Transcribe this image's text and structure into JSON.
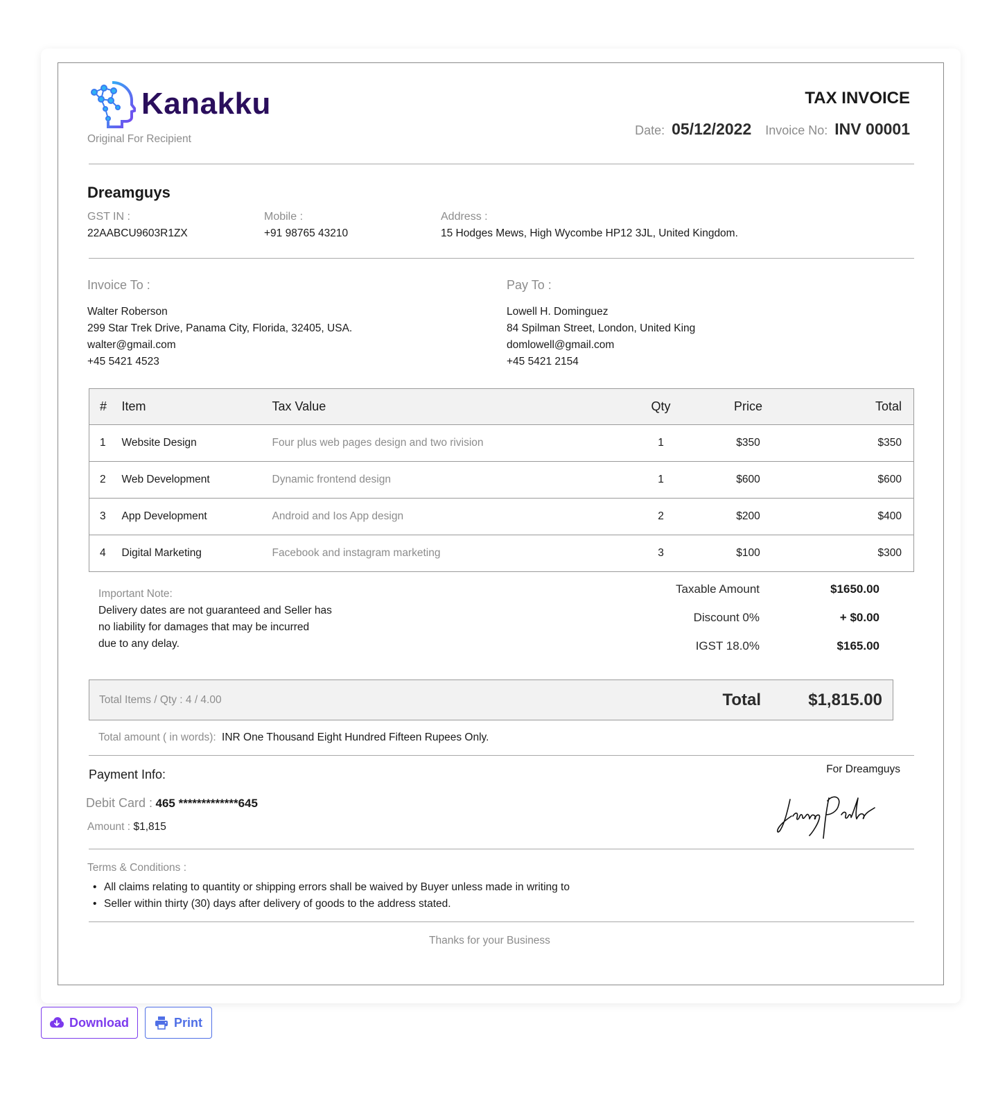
{
  "brand": {
    "name": "Kanakku",
    "copy_type": "Original For Recipient"
  },
  "invoice": {
    "title": "TAX INVOICE",
    "date_label": "Date:",
    "date": "05/12/2022",
    "number_label": "Invoice No:",
    "number": "INV 00001"
  },
  "seller": {
    "name": "Dreamguys",
    "gst_label": "GST IN :",
    "gst": "22AABCU9603R1ZX",
    "mobile_label": "Mobile :",
    "mobile": "+91 98765 43210",
    "address_label": "Address :",
    "address": "15 Hodges Mews, High Wycombe HP12 3JL, United Kingdom."
  },
  "invoice_to": {
    "label": "Invoice To :",
    "name": "Walter Roberson",
    "address": "299 Star Trek Drive, Panama City, Florida, 32405, USA.",
    "email": "walter@gmail.com",
    "phone": "+45 5421 4523"
  },
  "pay_to": {
    "label": "Pay To :",
    "name": "Lowell H. Dominguez",
    "address": "84 Spilman Street, London, United King",
    "email": "domlowell@gmail.com",
    "phone": "+45 5421 2154"
  },
  "table": {
    "headers": {
      "num": "#",
      "item": "Item",
      "tax": "Tax Value",
      "qty": "Qty",
      "price": "Price",
      "total": "Total"
    },
    "rows": [
      {
        "num": "1",
        "item": "Website Design",
        "desc": "Four plus web pages design and two rivision",
        "qty": "1",
        "price": "$350",
        "total": "$350"
      },
      {
        "num": "2",
        "item": "Web Development",
        "desc": "Dynamic frontend design",
        "qty": "1",
        "price": "$600",
        "total": "$600"
      },
      {
        "num": "3",
        "item": "App Development",
        "desc": "Android and Ios App design",
        "qty": "2",
        "price": "$200",
        "total": "$400"
      },
      {
        "num": "4",
        "item": "Digital Marketing",
        "desc": "Facebook and instagram marketing",
        "qty": "3",
        "price": "$100",
        "total": "$300"
      }
    ]
  },
  "note": {
    "label": "Important Note:",
    "line1": "Delivery dates are not guaranteed and Seller has",
    "line2": "no liability for damages that may be incurred",
    "line3": "due to any delay."
  },
  "summary": {
    "taxable_label": "Taxable Amount",
    "taxable": "$1650.00",
    "discount_label": "Discount 0%",
    "discount": "+ $0.00",
    "igst_label": "IGST 18.0%",
    "igst": "$165.00"
  },
  "totals": {
    "items_qty": "Total Items / Qty : 4 / 4.00",
    "total_label": "Total",
    "total": "$1,815.00",
    "words_label": "Total amount ( in words):",
    "words": "INR One Thousand Eight Hundred Fifteen Rupees Only."
  },
  "payment": {
    "title": "Payment Info:",
    "card_label": "Debit Card :",
    "card": "465 *************645",
    "amount_label": "Amount :",
    "amount": "$1,815",
    "for_label": "For Dreamguys"
  },
  "terms": {
    "label": "Terms & Conditions :",
    "line1": "All claims relating to quantity or shipping errors shall be waived by Buyer unless made in writing to",
    "line2": "Seller within thirty (30) days after delivery of goods to the address stated."
  },
  "footer": {
    "thanks": "Thanks for your Business"
  },
  "actions": {
    "download": "Download",
    "print": "Print"
  },
  "colors": {
    "brand_purple": "#2a0e5c",
    "accent": "#7c3aed",
    "print_blue": "#4f6fe6"
  }
}
